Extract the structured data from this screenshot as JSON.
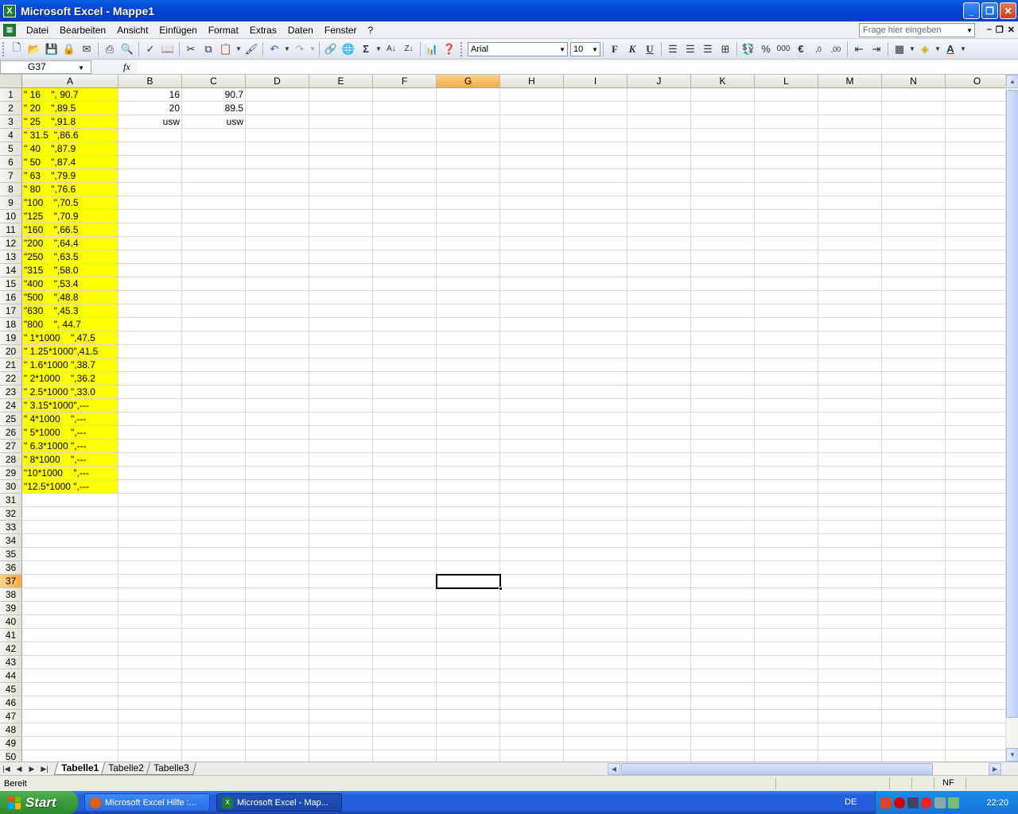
{
  "window": {
    "title": "Microsoft Excel - Mappe1"
  },
  "menu": {
    "items": [
      "Datei",
      "Bearbeiten",
      "Ansicht",
      "Einfügen",
      "Format",
      "Extras",
      "Daten",
      "Fenster",
      "?"
    ],
    "ask_placeholder": "Frage hier eingeben"
  },
  "toolbar": {
    "font_name": "Arial",
    "font_size": "10"
  },
  "formula_bar": {
    "name_box": "G37",
    "fx": "fx",
    "content": ""
  },
  "sheet": {
    "columns": [
      "A",
      "B",
      "C",
      "D",
      "E",
      "F",
      "G",
      "H",
      "I",
      "J",
      "K",
      "L",
      "M",
      "N",
      "O"
    ],
    "selected_column": "G",
    "selected_row": 37,
    "active_cell": "G37",
    "visible_rows": 50,
    "highlight_color": "#ffff00",
    "col_a": [
      "\" 16    \", 90.7",
      "\" 20    \",89.5",
      "\" 25    \",91.8",
      "\" 31.5  \",86.6",
      "\" 40    \",87.9",
      "\" 50    \",87.4",
      "\" 63    \",79.9",
      "\" 80    \",76.6",
      "\"100    \",70.5",
      "\"125    \",70.9",
      "\"160    \",66.5",
      "\"200    \",64.4",
      "\"250    \",63.5",
      "\"315    \",58.0",
      "\"400    \",53.4",
      "\"500    \",48.8",
      "\"630    \",45.3",
      "\"800    \", 44.7",
      "\" 1*1000    \",47.5",
      "\" 1.25*1000\",41.5",
      "\" 1.6*1000 \",38.7",
      "\" 2*1000    \",36.2",
      "\" 2.5*1000 \",33.0",
      "\" 3.15*1000\",---",
      "\" 4*1000    \",---",
      "\" 5*1000    \",---",
      "\" 6.3*1000 \",---",
      "\" 8*1000    \",---",
      "\"10*1000    \",---",
      "\"12.5*1000 \",---"
    ],
    "col_b": [
      "16",
      "20",
      "usw"
    ],
    "col_c": [
      "90.7",
      "89.5",
      "usw"
    ]
  },
  "tabs": [
    "Tabelle1",
    "Tabelle2",
    "Tabelle3"
  ],
  "active_tab": "Tabelle1",
  "status": {
    "left": "Bereit",
    "nf": "NF"
  },
  "taskbar": {
    "start": "Start",
    "items": [
      "Microsoft Excel Hilfe :...",
      "Microsoft Excel - Map..."
    ],
    "lang": "DE",
    "clock": "22:20"
  }
}
